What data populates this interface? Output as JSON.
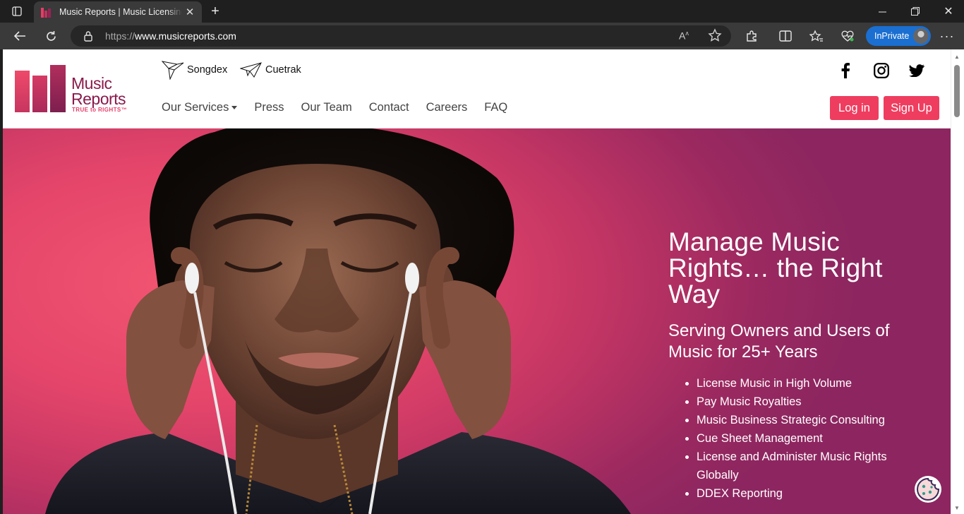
{
  "browser": {
    "tab_title": "Music Reports | Music Licensing & Royalties",
    "url_protocol": "https://",
    "url_host": "www.musicreports.com",
    "inprivate_label": "InPrivate",
    "icons": [
      "tab-actions-icon",
      "close-icon",
      "new-tab-icon",
      "back-icon",
      "refresh-icon",
      "lock-icon",
      "read-aloud-icon",
      "favorite-star-icon",
      "extensions-icon",
      "split-screen-icon",
      "favorites-icon",
      "browser-essentials-icon",
      "more-icon",
      "minimize-icon",
      "restore-icon",
      "window-close-icon"
    ]
  },
  "site": {
    "logo": {
      "line1": "Music",
      "line2": "Reports",
      "tagline": "TRUE to RIGHTS™"
    },
    "sub_brands": [
      {
        "label": "Songdex"
      },
      {
        "label": "Cuetrak"
      }
    ],
    "nav": [
      {
        "label": "Our Services",
        "dropdown": true
      },
      {
        "label": "Press"
      },
      {
        "label": "Our Team"
      },
      {
        "label": "Contact"
      },
      {
        "label": "Careers"
      },
      {
        "label": "FAQ"
      }
    ],
    "social": [
      "facebook-icon",
      "instagram-icon",
      "twitter-icon"
    ],
    "buttons": {
      "login": "Log in",
      "signup": "Sign Up"
    },
    "hero": {
      "headline_line1": "Manage Music",
      "headline_line2": "Rights… the Right Way",
      "subhead_line1": "Serving Owners and Users of",
      "subhead_line2": "Music for 25+ Years",
      "bullets": [
        "License Music in High Volume",
        "Pay Music Royalties",
        "Music Business Strategic Consulting",
        "Cue Sheet Management",
        "License and Administer Music Rights Globally",
        "DDEX Reporting"
      ]
    }
  },
  "colors": {
    "brand_pink": "#ef3d5f",
    "brand_plum": "#8a1a4b",
    "hero_gradient_start": "#f25671",
    "hero_gradient_end": "#8d2660",
    "browser_accent": "#1a6fd1"
  }
}
